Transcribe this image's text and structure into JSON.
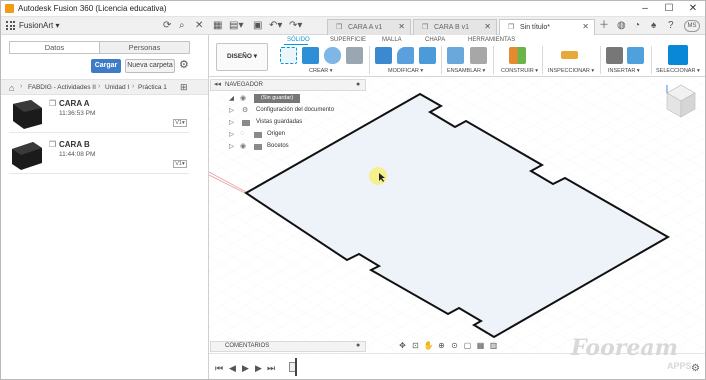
{
  "window": {
    "title": "Autodesk Fusion 360 (Licencia educativa)",
    "controls": [
      "–",
      "☐",
      "✕"
    ]
  },
  "left_panel": {
    "team_name": "FusionArt",
    "tabs": [
      "Datos",
      "Personas"
    ],
    "upload_button": "Cargar",
    "new_folder_button": "Nueva carpeta",
    "breadcrumbs": [
      "FABDIG - Actividades II",
      "Unidad I",
      "Práctica 1"
    ],
    "files": [
      {
        "name": "CARA A",
        "time": "11:36:53 PM",
        "version": "V1"
      },
      {
        "name": "CARA B",
        "time": "11:44:08 PM",
        "version": "V1"
      }
    ]
  },
  "doc_tabs": [
    {
      "label": "CARA A v1",
      "active": false
    },
    {
      "label": "CARA B v1",
      "active": false
    },
    {
      "label": "Sin título*",
      "active": true
    }
  ],
  "toolbar": {
    "tabs": [
      "SÓLIDO",
      "SUPERFICIE",
      "MALLA",
      "CHAPA",
      "HERRAMIENTAS"
    ],
    "active_tab": "SÓLIDO",
    "workspace_button": "DISEÑO ▾",
    "groups": [
      "CREAR ▾",
      "MODIFICAR ▾",
      "ENSAMBLAR ▾",
      "CONSTRUIR ▾",
      "INSPECCIONAR ▾",
      "INSERTAR ▾",
      "SELECCIONAR ▾"
    ]
  },
  "navigator": {
    "title": "NAVEGADOR",
    "root": "(Sin guardar)",
    "items": [
      "Configuración del documento",
      "Vistas guardadas",
      "Origen",
      "Bocetos"
    ]
  },
  "bottom": {
    "comments_label": "COMENTARIOS",
    "user_initials": "MS"
  },
  "watermark": {
    "brand": "Fooream",
    "sub": "APPS"
  },
  "colors": {
    "accent": "#0696d7",
    "upload_button": "#3e7cc7",
    "sketch_fill": "#eef3fa",
    "sketch_stroke": "#111111"
  }
}
